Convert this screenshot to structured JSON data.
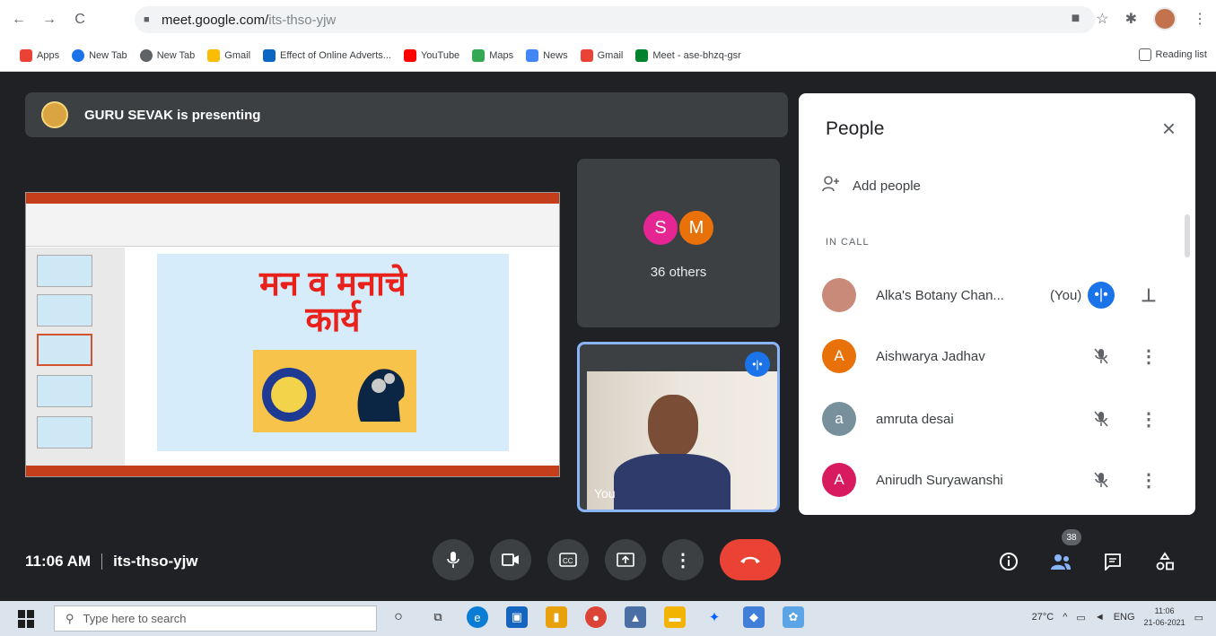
{
  "browser": {
    "url_host": "meet.google.com/",
    "url_path": "its-thso-yjw",
    "nav": {
      "back": "←",
      "forward": "→",
      "reload": "C"
    },
    "icons": [
      "camera-icon",
      "star-icon",
      "extensions-icon",
      "profile-avatar",
      "menu-icon"
    ]
  },
  "bookmarks": {
    "items": [
      {
        "label": "Apps",
        "color": "#ea4335"
      },
      {
        "label": "New Tab",
        "color": "#1a73e8"
      },
      {
        "label": "New Tab",
        "color": "#5f6368"
      },
      {
        "label": "Gmail",
        "color": "#fbbc04"
      },
      {
        "label": "Effect of Online Adverts...",
        "color": "#0a66c2"
      },
      {
        "label": "YouTube",
        "color": "#ff0000"
      },
      {
        "label": "Maps",
        "color": "#34a853"
      },
      {
        "label": "News",
        "color": "#4285f4"
      },
      {
        "label": "Gmail",
        "color": "#ea4335"
      },
      {
        "label": "Meet - ase-bhzq-gsr",
        "color": "#00832d"
      }
    ],
    "reading_list": "Reading list"
  },
  "meet": {
    "presenting": "GURU SEVAK is presenting",
    "slide": {
      "title_line1": "मन व मनाचे",
      "title_line2": "कार्य"
    },
    "others_tile": {
      "avatar1": "S",
      "avatar2": "M",
      "label": "36 others"
    },
    "self_tile": {
      "label": "You"
    }
  },
  "people_panel": {
    "title": "People",
    "close": "×",
    "add_people": "Add people",
    "in_call": "IN CALL",
    "participants": [
      {
        "initial": "",
        "name": "Alka's Botany Chan...",
        "you": "(You)",
        "avatar_color": "#c98a7a",
        "speaking": true
      },
      {
        "initial": "A",
        "name": "Aishwarya Jadhav",
        "avatar_color": "#e8710a",
        "speaking": false
      },
      {
        "initial": "a",
        "name": "amruta desai",
        "avatar_color": "#78909c",
        "speaking": false
      },
      {
        "initial": "A",
        "name": "Anirudh Suryawanshi",
        "avatar_color": "#d81b60",
        "speaking": false
      }
    ]
  },
  "bottom_bar": {
    "time": "11:06 AM",
    "meeting_code": "its-thso-yjw",
    "people_count": "38"
  },
  "taskbar": {
    "search_placeholder": "Type here to search",
    "weather": "27°C",
    "lang": "ENG",
    "clock_time": "11:06",
    "clock_date": "21-06-2021"
  }
}
